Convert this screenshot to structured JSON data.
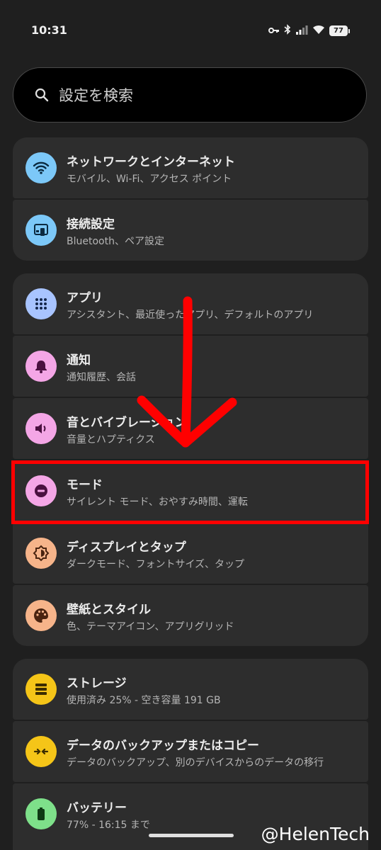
{
  "status_bar": {
    "time": "10:31",
    "battery": "77"
  },
  "search": {
    "placeholder": "設定を検索"
  },
  "groups": [
    {
      "items": [
        {
          "title": "ネットワークとインターネット",
          "subtitle": "モバイル、Wi-Fi、アクセス ポイント",
          "icon": "wifi-icon",
          "color": "#7cc8f8"
        },
        {
          "title": "接続設定",
          "subtitle": "Bluetooth、ペア設定",
          "icon": "devices-icon",
          "color": "#7cc8f8"
        }
      ]
    },
    {
      "items": [
        {
          "title": "アプリ",
          "subtitle": "アシスタント、最近使ったアプリ、デフォルトのアプリ",
          "icon": "apps-grid-icon",
          "color": "#a8c4ff"
        },
        {
          "title": "通知",
          "subtitle": "通知履歴、会話",
          "icon": "bell-icon",
          "color": "#f4a6e6"
        },
        {
          "title": "音とバイブレーション",
          "subtitle": "音量とハプティクス",
          "icon": "speaker-icon",
          "color": "#f4a6e6"
        },
        {
          "title": "モード",
          "subtitle": "サイレント モード、おやすみ時間、運転",
          "icon": "do-not-disturb-icon",
          "color": "#f4a6e6"
        },
        {
          "title": "ディスプレイとタップ",
          "subtitle": "ダークモード、フォントサイズ、タップ",
          "icon": "brightness-icon",
          "color": "#f6b48a"
        },
        {
          "title": "壁紙とスタイル",
          "subtitle": "色、テーマアイコン、アプリグリッド",
          "icon": "palette-icon",
          "color": "#f6b48a"
        }
      ]
    },
    {
      "items": [
        {
          "title": "ストレージ",
          "subtitle": "使用済み 25% - 空き容量 191 GB",
          "icon": "storage-icon",
          "color": "#f5c518"
        },
        {
          "title": "データのバックアップまたはコピー",
          "subtitle": "データのバックアップ、別のデバイスからのデータの移行",
          "icon": "transfer-icon",
          "color": "#f5c518"
        },
        {
          "title": "バッテリー",
          "subtitle": "77% - 16:15 まで",
          "icon": "battery-icon",
          "color": "#7ee08a"
        }
      ]
    }
  ],
  "watermark": "@HelenTech",
  "annotation": {
    "highlight_color": "#ff0000"
  }
}
